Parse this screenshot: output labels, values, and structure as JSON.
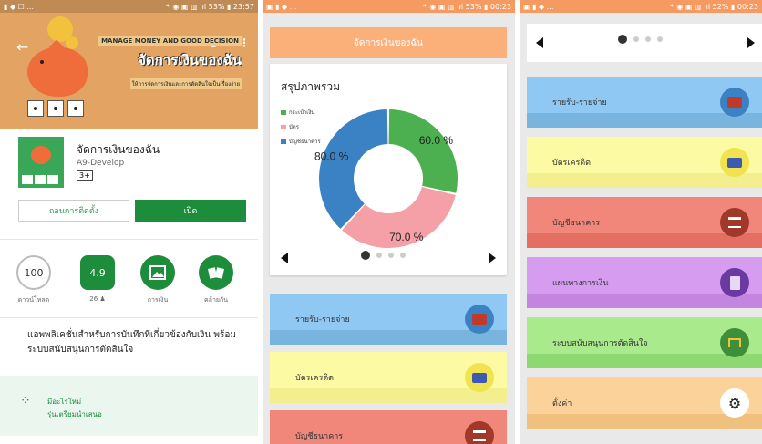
{
  "panel1": {
    "status": {
      "left": "▮ ◆ ☐ ...",
      "right": "⁴ᴵ ◉ ▣ ▥ .ıl 53% ▮ 23:57"
    },
    "banner": {
      "subtitle_top": "MANAGE MONEY AND GOOD DECISION",
      "title": "จัดการเงินของฉัน",
      "subtitle_bottom": "ให้การจัดการเงินและการตัดสินใจเป็นเรื่องง่าย"
    },
    "app": {
      "name": "จัดการเงินของฉัน",
      "developer": "A9-Develop",
      "rating": "3+"
    },
    "buttons": {
      "uninstall": "ถอนการติดตั้ง",
      "open": "เปิด"
    },
    "stats": [
      {
        "value": "100",
        "label": "ดาวน์โหลด"
      },
      {
        "value": "4.9",
        "label": "26 ♟"
      },
      {
        "value": "",
        "label": "การเงิน"
      },
      {
        "value": "",
        "label": "คล้ายกัน"
      }
    ],
    "description": "แอพพลิเคชั่นสำหรับการบันทึกที่เกี่ยวข้องกับเงิน พร้อมระบบสนับสนุนการตัดสินใจ",
    "news": {
      "title": "มีอะไรใหม่",
      "subtitle": "รุ่นเตรียมนำเสนอ"
    }
  },
  "panel2": {
    "status": {
      "left": "▣ ▮ ◆ ...",
      "right": "⁴ᴵ ◉ ▣ ▥ .ıl 53% ▮ 00:23"
    },
    "header": "จัดการเงินของฉัน",
    "summary_title": "สรุปภาพรวม",
    "legend": [
      {
        "label": "กระเป๋าเงิน",
        "color": "#4caf50"
      },
      {
        "label": "บัตร",
        "color": "#f4a0a6"
      },
      {
        "label": "บัญชีธนาคาร",
        "color": "#3b82c4"
      }
    ],
    "menu": [
      {
        "label": "รายรับ-รายจ่าย",
        "icon": "wallet-icon"
      },
      {
        "label": "บัตรเครดิต",
        "icon": "credit-card-icon"
      },
      {
        "label": "บัญชีธนาคาร",
        "icon": "bank-icon"
      }
    ]
  },
  "panel3": {
    "status": {
      "left": "▣ ▮ ◆ ...",
      "right": "⁴ᴵ ◉ ▣ ▥ .ıl 52% ▮ 00:23"
    },
    "menu": [
      {
        "label": "รายรับ-รายจ่าย",
        "icon": "wallet-icon"
      },
      {
        "label": "บัตรเครดิต",
        "icon": "credit-card-icon"
      },
      {
        "label": "บัญชีธนาคาร",
        "icon": "bank-icon"
      },
      {
        "label": "แผนทางการเงิน",
        "icon": "notebook-icon"
      },
      {
        "label": "ระบบสนับสนุนการตัดสินใจ",
        "icon": "decision-tree-icon"
      },
      {
        "label": "ตั้งค่า",
        "icon": "gear-icon"
      }
    ]
  },
  "colors": {
    "orange_banner": "#e2a363",
    "header_orange": "#fbb07a",
    "blue": "#8fc8f2",
    "yellow": "#fdfaa4",
    "red": "#f0877a",
    "purple": "#d59cf0",
    "green": "#a9ea8c",
    "peach": "#fbd39a"
  },
  "chart_data": {
    "type": "pie",
    "categories": [
      "กระเป๋าเงิน",
      "บัตร",
      "บัญชีธนาคาร"
    ],
    "values": [
      60.0,
      70.0,
      80.0
    ],
    "data_labels": [
      "60.0 %",
      "70.0 %",
      "80.0 %"
    ],
    "colors": [
      "#4caf50",
      "#f4a0a6",
      "#3b82c4"
    ]
  }
}
